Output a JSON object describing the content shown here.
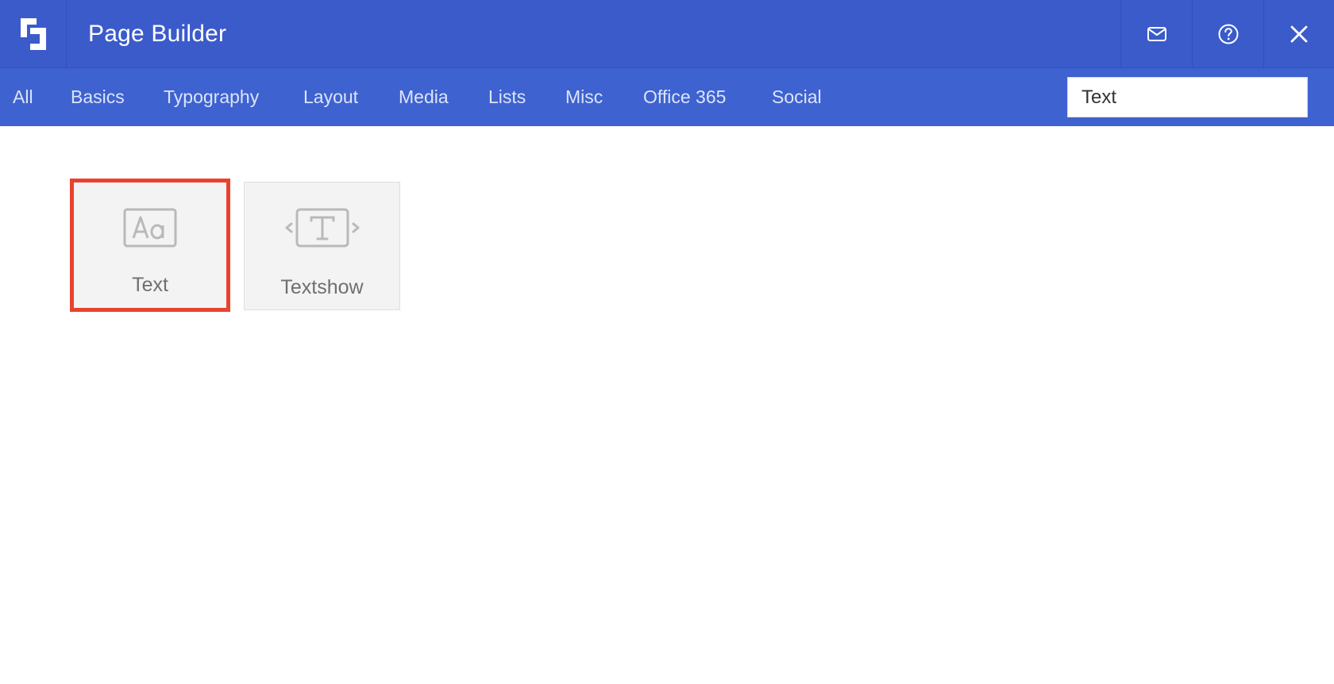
{
  "header": {
    "title": "Page Builder",
    "logo_icon": "page-builder-logo-icon",
    "actions": [
      {
        "icon": "mail-icon"
      },
      {
        "icon": "help-icon"
      },
      {
        "icon": "close-icon"
      }
    ]
  },
  "categories": [
    "All",
    "Basics",
    "Typography",
    "Layout",
    "Media",
    "Lists",
    "Misc",
    "Office 365",
    "Social"
  ],
  "search": {
    "value": "Text"
  },
  "results": [
    {
      "label": "Text",
      "icon": "text-aa-icon",
      "highlighted": true
    },
    {
      "label": "Textshow",
      "icon": "textshow-icon",
      "highlighted": false
    }
  ],
  "colors": {
    "header_bg": "#3b5bcb",
    "catbar_bg": "#3e62cf",
    "highlight": "#e8432f",
    "tile_bg": "#f3f3f3"
  }
}
